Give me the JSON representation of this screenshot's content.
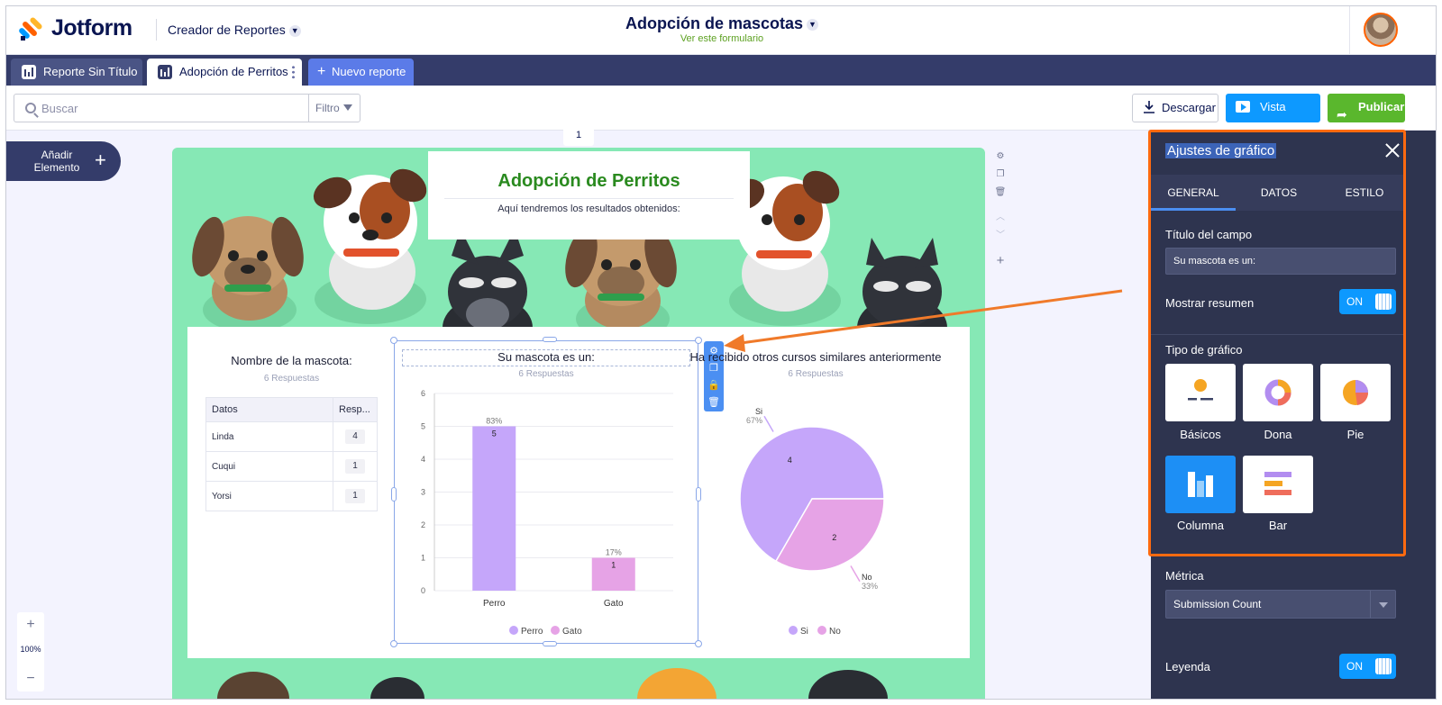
{
  "app": {
    "brand": "Jotform",
    "section": "Creador de Reportes",
    "form_title": "Adopción de mascotas",
    "form_link": "Ver este formulario"
  },
  "tabs": [
    {
      "label": "Reporte Sin Título"
    },
    {
      "label": "Adopción de Perritos"
    },
    {
      "label": "Nuevo reporte"
    }
  ],
  "toolbar": {
    "search_placeholder": "Buscar",
    "filter_label": "Filtro",
    "download_label": "Descargar",
    "preview_label": "Vista previa",
    "publish_label": "Publicar"
  },
  "canvas": {
    "add_element": "Añadir Elemento",
    "page_number": "1",
    "zoom": "100%"
  },
  "header": {
    "title": "Adopción de Perritos",
    "subtitle": "Aquí tendremos los resultados obtenidos:"
  },
  "widgets": {
    "table": {
      "title": "Nombre de la mascota:",
      "responses": "6 Respuestas",
      "columns": [
        "Datos",
        "Resp..."
      ],
      "rows": [
        {
          "name": "Linda",
          "count": "4"
        },
        {
          "name": "Cuqui",
          "count": "1"
        },
        {
          "name": "Yorsi",
          "count": "1"
        }
      ]
    },
    "bar": {
      "responses": "6 Respuestas"
    },
    "pie": {
      "title": "Ha recibido otros cursos similares anteriormente",
      "responses": "6 Respuestas"
    }
  },
  "chart_data": [
    {
      "type": "bar",
      "title": "Su mascota es un:",
      "categories": [
        "Perro",
        "Gato"
      ],
      "values": [
        5,
        1
      ],
      "percent_labels": [
        "83%",
        "17%"
      ],
      "ylim": [
        0,
        6
      ],
      "yticks": [
        0,
        1,
        2,
        3,
        4,
        5,
        6
      ],
      "colors": [
        "#c5a6fa",
        "#e6a3e6"
      ],
      "legend": "bottom",
      "grid": true
    },
    {
      "type": "pie",
      "title": "Ha recibido otros cursos similares anteriormente",
      "categories": [
        "Si",
        "No"
      ],
      "values": [
        4,
        2
      ],
      "percent_labels": [
        "67%",
        "33%"
      ],
      "colors": [
        "#c5a6fa",
        "#e6a3e6"
      ],
      "legend": "bottom"
    }
  ],
  "settings": {
    "title": "Ajustes de gráfico",
    "tabs": [
      "GENERAL",
      "DATOS",
      "ESTILO"
    ],
    "field_title_label": "Título del campo",
    "field_title_value": "Su mascota es un:",
    "show_summary_label": "Mostrar resumen",
    "show_summary_state": "ON",
    "chart_type_label": "Tipo de gráfico",
    "chart_types": [
      "Básicos",
      "Dona",
      "Pie",
      "Columna",
      "Bar"
    ],
    "selected_chart_type": "Columna",
    "metric_label": "Métrica",
    "metric_value": "Submission Count",
    "legend_label": "Leyenda",
    "legend_state": "ON"
  },
  "colors": {
    "navy": "#0a1551",
    "tab_bar": "#343c6a",
    "accent_blue": "#0d99ff",
    "publish_green": "#5ab72d",
    "highlight_orange": "#ff6a10",
    "report_bg": "#86e8b5",
    "settings_bg": "#2e344f"
  }
}
